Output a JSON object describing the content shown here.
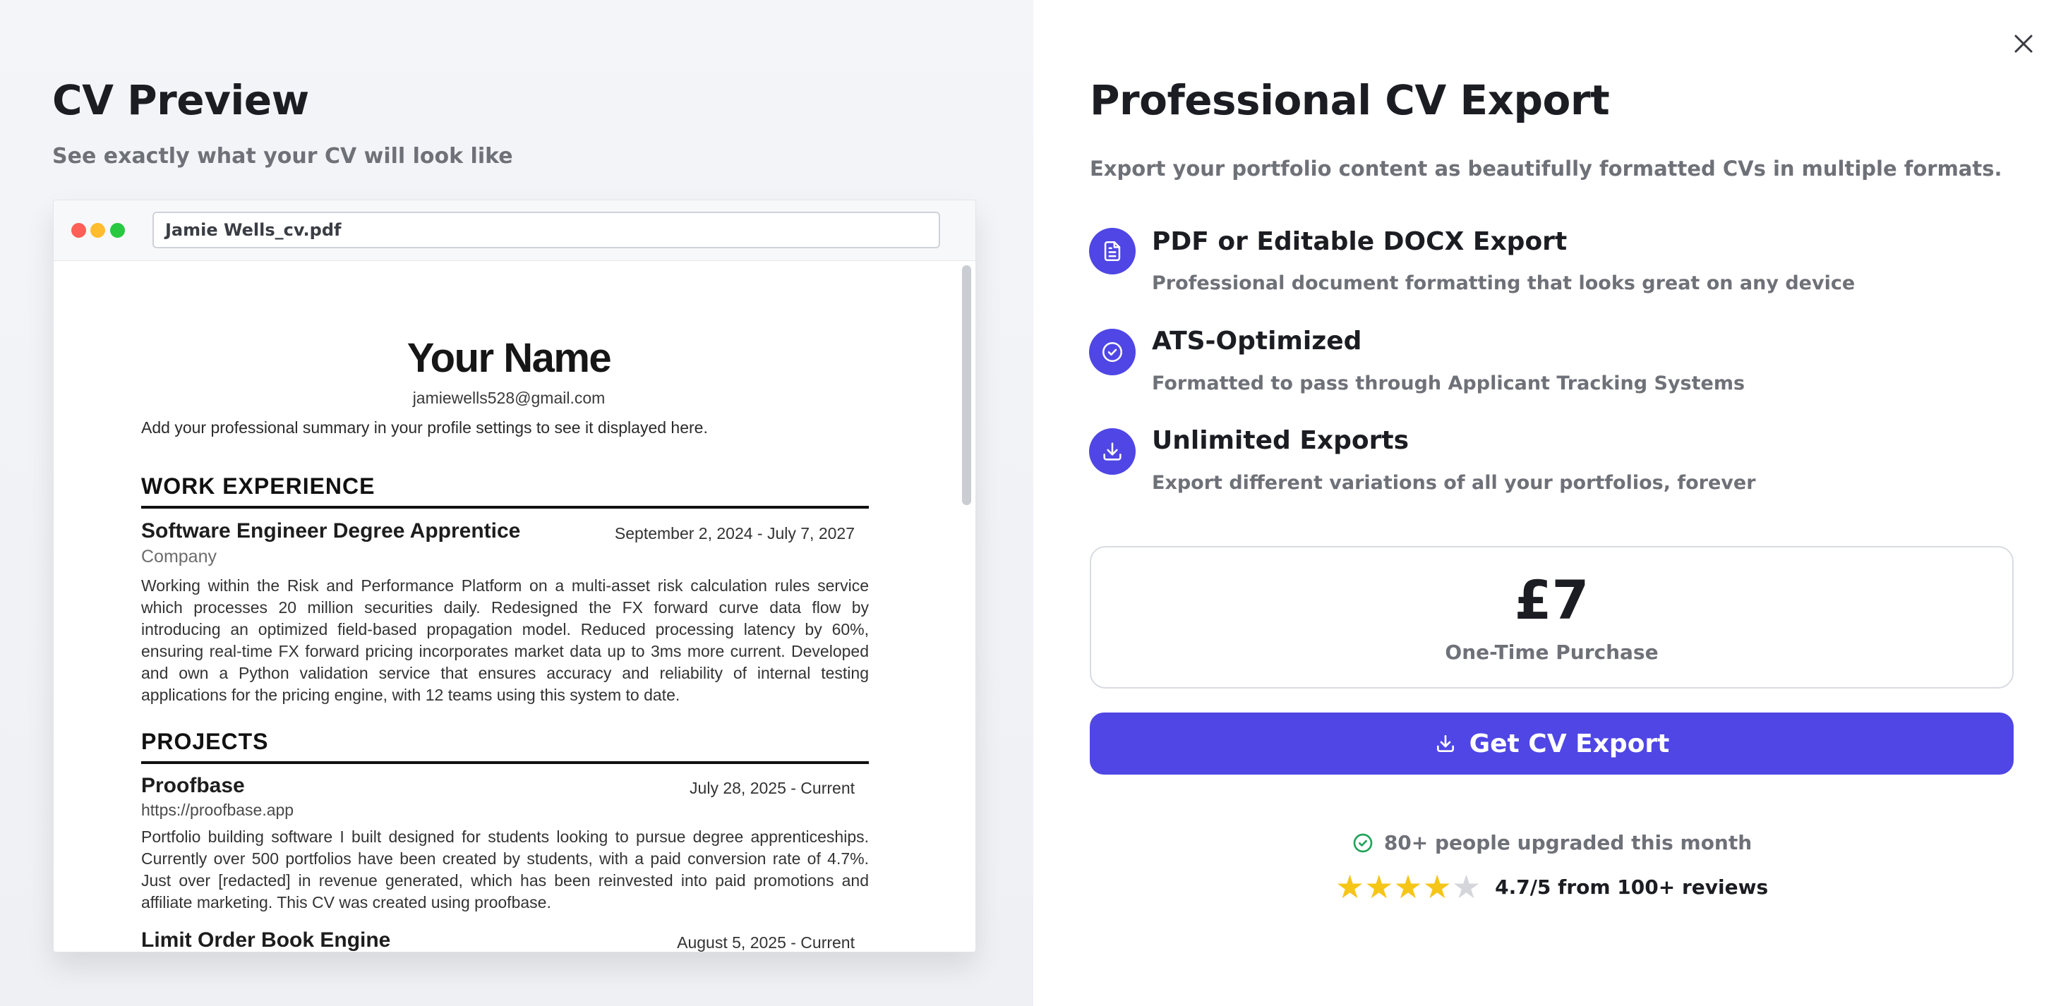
{
  "preview": {
    "title": "CV Preview",
    "subtitle": "See exactly what your CV will look like",
    "filename": "Jamie Wells_cv.pdf"
  },
  "cv": {
    "name": "Your Name",
    "email": "jamiewells528@gmail.com",
    "summary": "Add your professional summary in your profile settings to see it displayed here.",
    "work_heading": "WORK EXPERIENCE",
    "work": {
      "title": "Software Engineer Degree Apprentice",
      "dates": "September 2, 2024 - July 7, 2027",
      "company": "Company",
      "description": "Working within the Risk and Performance Platform on a multi-asset risk calculation rules service which processes 20 million securities daily. Redesigned the FX forward curve data flow by introducing an optimized field-based propagation model. Reduced processing latency by 60%, ensuring real-time FX forward pricing incorporates market data up to 3ms more current. Developed and own a Python validation service that ensures accuracy and reliability of internal testing applications for the pricing engine, with 12 teams using this system to date."
    },
    "projects_heading": "PROJECTS",
    "projects": [
      {
        "title": "Proofbase",
        "dates": "July 28, 2025 - Current",
        "link": "https://proofbase.app",
        "description": "Portfolio building software I built designed for students looking to pursue degree apprenticeships. Currently over 500 portfolios have been created by students, with a paid conversion rate of 4.7%. Just over [redacted] in revenue generated, which has been reinvested into paid promotions and affiliate marketing. This CV was created using proofbase."
      },
      {
        "title": "Limit Order Book Engine",
        "dates": "August 5, 2025 - Current"
      }
    ]
  },
  "export": {
    "title": "Professional CV Export",
    "subtitle": "Export your portfolio content as beautifully formatted CVs in multiple formats.",
    "features": [
      {
        "icon": "document-icon",
        "title": "PDF or Editable DOCX Export",
        "desc": "Professional document formatting that looks great on any device"
      },
      {
        "icon": "check-circle-icon",
        "title": "ATS-Optimized",
        "desc": "Formatted to pass through Applicant Tracking Systems"
      },
      {
        "icon": "download-icon",
        "title": "Unlimited Exports",
        "desc": "Export different variations of all your portfolios, forever"
      }
    ],
    "price": "£7",
    "price_label": "One-Time Purchase",
    "button_label": "Get CV Export",
    "upgraded_text": "80+ people upgraded this month",
    "rating_text": "4.7/5 from 100+ reviews",
    "rating": 4.7,
    "accent_color": "#4f46e5",
    "star_color": "#f5c518",
    "success_color": "#22a35a"
  }
}
